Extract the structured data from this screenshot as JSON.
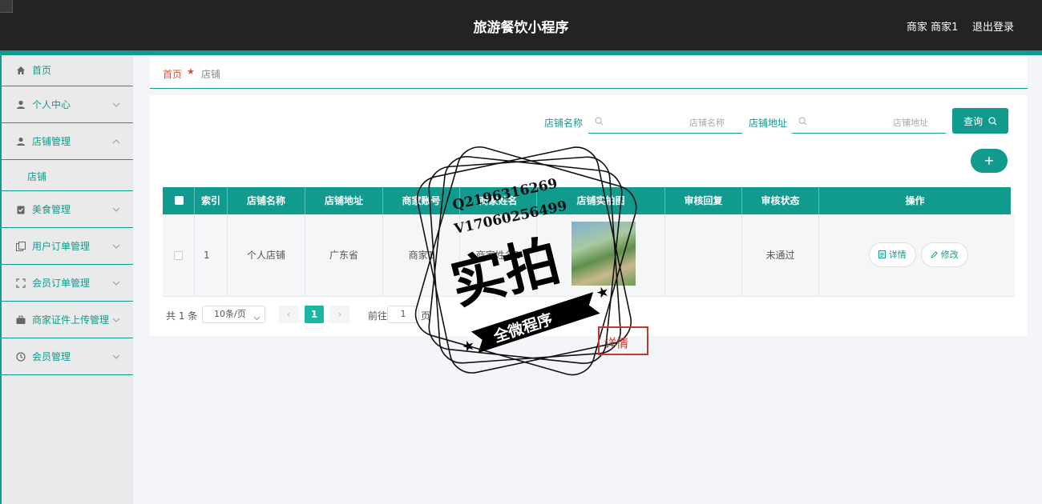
{
  "app": {
    "title": "旅游餐饮小程序",
    "user": "商家 商家1",
    "logout": "退出登录"
  },
  "sidebar": {
    "items": [
      {
        "label": "首页",
        "icon": "home-icon"
      },
      {
        "label": "个人中心",
        "icon": "user-icon"
      },
      {
        "label": "店铺管理",
        "icon": "user-icon",
        "expanded": true
      },
      {
        "label": "店铺"
      },
      {
        "label": "美食管理",
        "icon": "clipboard-icon"
      },
      {
        "label": "用户订单管理",
        "icon": "copy-icon"
      },
      {
        "label": "会员订单管理",
        "icon": "fullscreen-icon"
      },
      {
        "label": "商家证件上传管理",
        "icon": "briefcase-icon"
      },
      {
        "label": "会员管理",
        "icon": "clock-icon"
      }
    ]
  },
  "breadcrumb": {
    "home": "首页",
    "current": "店铺"
  },
  "search": {
    "name_label": "店铺名称",
    "name_placeholder": "店铺名称",
    "address_label": "店铺地址",
    "address_placeholder": "店铺地址",
    "query_button": "查询",
    "add_button": "+"
  },
  "table": {
    "headers": [
      "索引",
      "店铺名称",
      "店铺地址",
      "商家账号",
      "商家姓名",
      "店铺实拍图",
      "审核回复",
      "审核状态",
      "操作"
    ],
    "rows": [
      {
        "index": "1",
        "name": "个人店铺",
        "address": "广东省",
        "account": "商家1",
        "merchant_name": "商家姓名1",
        "reply": "",
        "status": "未通过"
      }
    ],
    "detail_button": "详情",
    "edit_button": "修改"
  },
  "pagination": {
    "total": "共 1 条",
    "page_size": "10条/页",
    "current": "1",
    "goto_label": "前往",
    "goto_value": "1",
    "goto_unit": "页"
  },
  "watermark": {
    "line1": "Q2196316269",
    "line2": "V17060256499",
    "big": "实拍",
    "banner": "全微程序",
    "red_box": "详情"
  },
  "colors": {
    "accent": "#119a8e",
    "header_bg": "#232323",
    "sidebar_bg": "#eaeaea",
    "crumb_red": "#d4543c"
  }
}
